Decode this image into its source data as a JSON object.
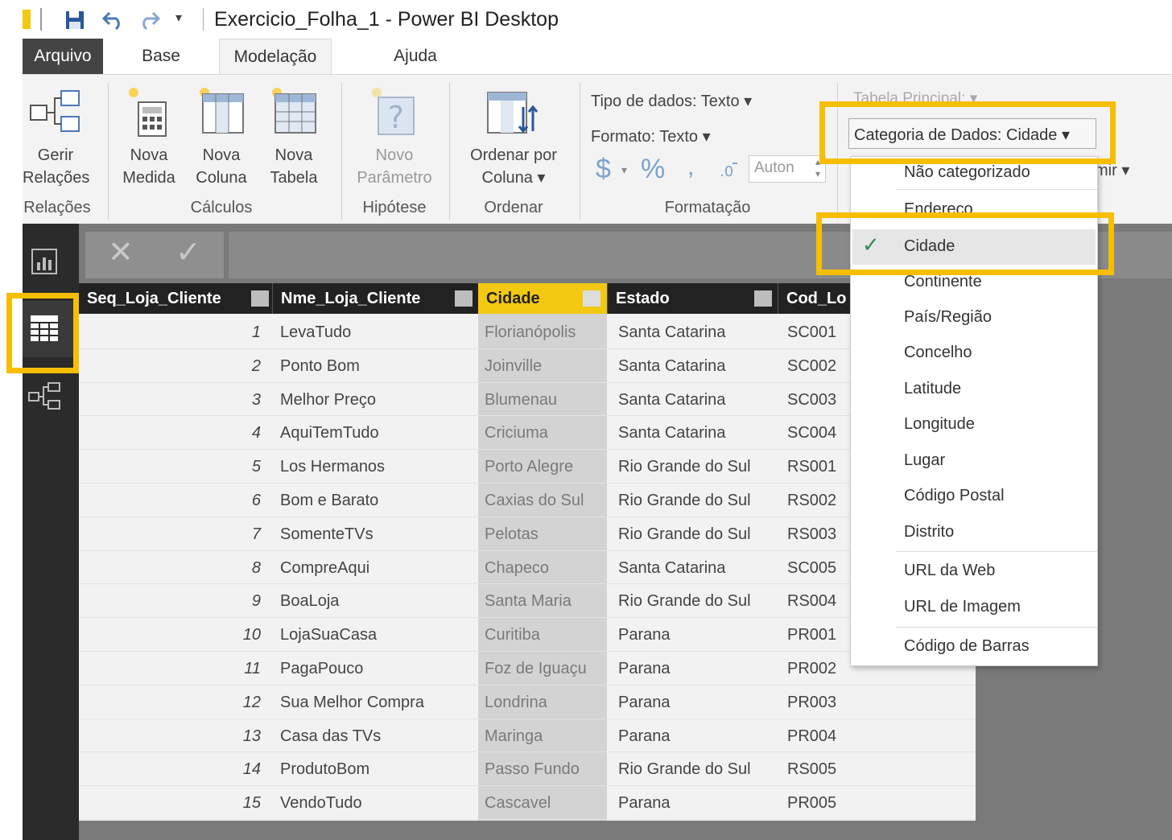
{
  "window": {
    "title": "Exercicio_Folha_1 - Power BI Desktop"
  },
  "tabs": [
    "Arquivo",
    "Base",
    "Modelação",
    "Ajuda"
  ],
  "ribbon": {
    "relacoes": {
      "button": [
        "Gerir",
        "Relações"
      ],
      "group": "Relações"
    },
    "calculos": {
      "buttons": [
        [
          "Nova",
          "Medida"
        ],
        [
          "Nova",
          "Coluna"
        ],
        [
          "Nova",
          "Tabela"
        ]
      ],
      "group": "Cálculos"
    },
    "hipotese": {
      "button": [
        "Novo",
        "Parâmetro"
      ],
      "group": "Hipótese"
    },
    "ordenar": {
      "button": [
        "Ordenar por",
        "Coluna ▾"
      ],
      "group": "Ordenar"
    },
    "formatacao": {
      "tipo": "Tipo de dados: Texto ▾",
      "formato": "Formato: Texto ▾",
      "currency": "$",
      "percent": "%",
      "comma": ",",
      "auto": "Auton",
      "group": "Formatação"
    },
    "propriedades": {
      "tabela": "Tabela Principal: ▾",
      "categoria": "Categoria de Dados: Cidade ▾",
      "resumir": "mir ▾"
    }
  },
  "dropdown": {
    "items": [
      "Não categorizado",
      "Endereço",
      "Cidade",
      "Continente",
      "País/Região",
      "Concelho",
      "Latitude",
      "Longitude",
      "Lugar",
      "Código Postal",
      "Distrito",
      "URL da Web",
      "URL de Imagem",
      "Código de Barras"
    ],
    "selected": "Cidade",
    "check": "✓"
  },
  "table": {
    "columns": [
      "Seq_Loja_Cliente",
      "Nme_Loja_Cliente",
      "Cidade",
      "Estado",
      "Cod_Lo"
    ],
    "rows": [
      [
        "1",
        "LevaTudo",
        "Florianópolis",
        "Santa Catarina",
        "SC001"
      ],
      [
        "2",
        "Ponto Bom",
        "Joinville",
        "Santa Catarina",
        "SC002"
      ],
      [
        "3",
        "Melhor Preço",
        "Blumenau",
        "Santa Catarina",
        "SC003"
      ],
      [
        "4",
        "AquiTemTudo",
        "Criciuma",
        "Santa Catarina",
        "SC004"
      ],
      [
        "5",
        "Los Hermanos",
        "Porto Alegre",
        "Rio Grande do Sul",
        "RS001"
      ],
      [
        "6",
        "Bom e Barato",
        "Caxias do Sul",
        "Rio Grande do Sul",
        "RS002"
      ],
      [
        "7",
        "SomenteTVs",
        "Pelotas",
        "Rio Grande do Sul",
        "RS003"
      ],
      [
        "8",
        "CompreAqui",
        "Chapeco",
        "Santa Catarina",
        "SC005"
      ],
      [
        "9",
        "BoaLoja",
        "Santa Maria",
        "Rio Grande do Sul",
        "RS004"
      ],
      [
        "10",
        "LojaSuaCasa",
        "Curitiba",
        "Parana",
        "PR001"
      ],
      [
        "11",
        "PagaPouco",
        "Foz de Iguaçu",
        "Parana",
        "PR002"
      ],
      [
        "12",
        "Sua Melhor Compra",
        "Londrina",
        "Parana",
        "PR003"
      ],
      [
        "13",
        "Casa das TVs",
        "Maringa",
        "Parana",
        "PR004"
      ],
      [
        "14",
        "ProdutoBom",
        "Passo Fundo",
        "Rio Grande do Sul",
        "RS005"
      ],
      [
        "15",
        "VendoTudo",
        "Cascavel",
        "Parana",
        "PR005"
      ]
    ]
  },
  "colors": {
    "highlight": "#f7be00",
    "selected_column": "#f2c811",
    "nav_bg": "#2b2b2b",
    "header_bg": "#222222"
  }
}
